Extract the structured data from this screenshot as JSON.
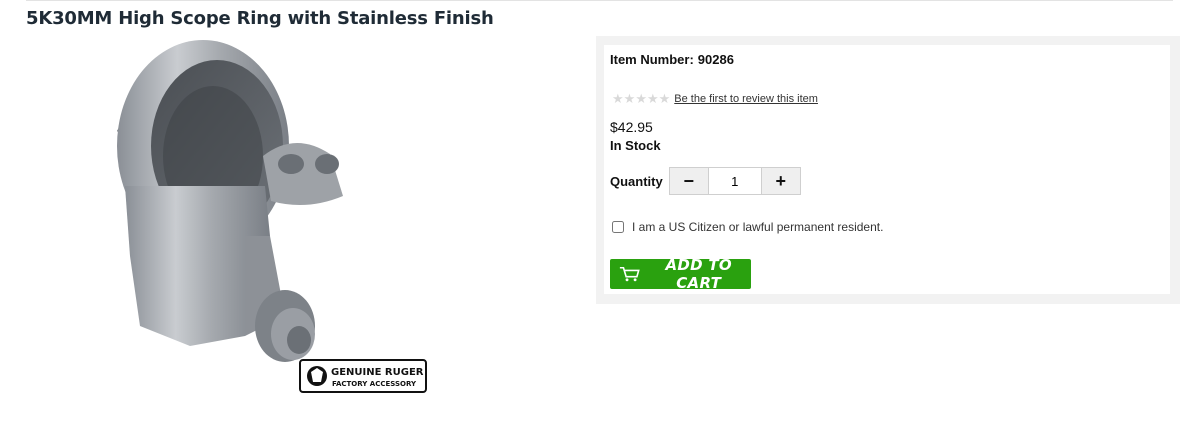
{
  "product": {
    "title": "5K30MM High Scope Ring with Stainless Finish",
    "badge_line1": "GENUINE RUGER",
    "badge_line2": "FACTORY ACCESSORY"
  },
  "buy_box": {
    "item_number_label": "Item Number:",
    "item_number": "90286",
    "rating": 0,
    "review_link": "Be the first to review this item",
    "price": "$42.95",
    "stock_status": "In Stock",
    "quantity_label": "Quantity",
    "quantity_value": "1",
    "minus_label": "−",
    "plus_label": "+",
    "citizen_checkbox_label": "I am a US Citizen or lawful permanent resident.",
    "add_to_cart_label": "ADD TO CART",
    "add_to_cart_color": "#2aa10f"
  }
}
